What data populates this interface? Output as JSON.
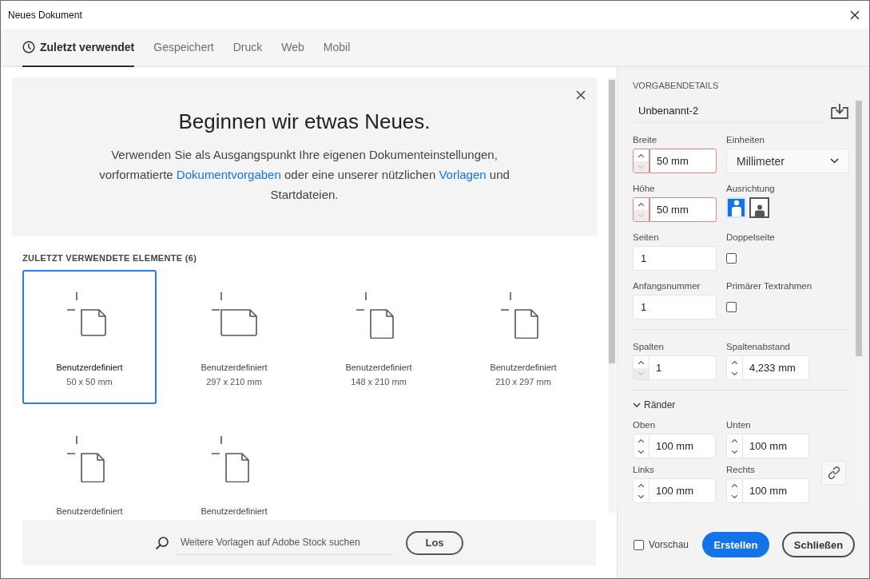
{
  "window": {
    "title": "Neues Dokument"
  },
  "tabs": [
    {
      "label": "Zuletzt verwendet",
      "selected": true
    },
    {
      "label": "Gespeichert",
      "selected": false
    },
    {
      "label": "Druck",
      "selected": false
    },
    {
      "label": "Web",
      "selected": false
    },
    {
      "label": "Mobil",
      "selected": false
    }
  ],
  "hero": {
    "heading": "Beginnen wir etwas Neues.",
    "parts": [
      {
        "kind": "text",
        "text": "Verwenden Sie als Ausgangspunkt Ihre eigenen Dokumenteinstellungen, vorformatierte "
      },
      {
        "kind": "link",
        "text": "Dokumentvorgaben"
      },
      {
        "kind": "text",
        "text": " oder eine unserer nützlichen "
      },
      {
        "kind": "link",
        "text": "Vorlagen"
      },
      {
        "kind": "text",
        "text": " und Startdateien."
      }
    ]
  },
  "recent": {
    "title": "ZULETZT VERWENDETE ELEMENTE",
    "count": "(6)",
    "items": [
      {
        "kind": "square",
        "name": "Benutzerdefiniert",
        "size": "50 x 50 mm",
        "selected": true
      },
      {
        "kind": "landscape",
        "name": "Benutzerdefiniert",
        "size": "297 x 210 mm",
        "selected": false
      },
      {
        "kind": "portrait",
        "name": "Benutzerdefiniert",
        "size": "148 x 210 mm",
        "selected": false
      },
      {
        "kind": "portrait",
        "name": "Benutzerdefiniert",
        "size": "210 x 297 mm",
        "selected": false
      },
      {
        "kind": "portrait",
        "name": "Benutzerdefiniert",
        "selected": false
      },
      {
        "kind": "portrait",
        "name": "Benutzerdefiniert",
        "selected": false
      }
    ]
  },
  "search": {
    "placeholder": "Weitere Vorlagen auf Adobe Stock suchen",
    "button": "Los"
  },
  "details": {
    "title": "VORGABENDETAILS",
    "name": "Unbenannt-2",
    "width": {
      "label": "Breite",
      "value": "50 mm",
      "invalid": true,
      "down_disabled": true
    },
    "units": {
      "label": "Einheiten",
      "value": "Millimeter"
    },
    "height": {
      "label": "Höhe",
      "value": "50 mm",
      "invalid": true,
      "down_disabled": true
    },
    "orientation": {
      "label": "Ausrichtung",
      "options": [
        {
          "kind": "portrait",
          "selected": true
        },
        {
          "kind": "landscape",
          "selected": false
        }
      ]
    },
    "pages": {
      "label": "Seiten",
      "value": "1"
    },
    "facing": {
      "label": "Doppelseite",
      "checked": false
    },
    "start": {
      "label": "Anfangsnummer",
      "value": "1"
    },
    "primary_frame": {
      "label": "Primärer Textrahmen",
      "checked": false
    },
    "columns": {
      "label": "Spalten",
      "value": "1",
      "invalid": false,
      "down_disabled": true
    },
    "gutter": {
      "label": "Spaltenabstand",
      "value": "4,233 mm",
      "invalid": false,
      "down_disabled": false
    },
    "margins": {
      "label": "Ränder",
      "expanded": true,
      "fields": [
        {
          "label": "Oben",
          "value": "100 mm",
          "invalid": false,
          "down_disabled": false
        },
        {
          "label": "Unten",
          "value": "100 mm",
          "invalid": false,
          "down_disabled": false
        },
        {
          "label": "Links",
          "value": "100 mm",
          "invalid": false,
          "down_disabled": false
        },
        {
          "label": "Rechts",
          "value": "100 mm",
          "invalid": false,
          "down_disabled": false
        }
      ]
    }
  },
  "footer": {
    "preview": {
      "label": "Vorschau",
      "checked": false
    },
    "create": "Erstellen",
    "close": "Schließen"
  }
}
